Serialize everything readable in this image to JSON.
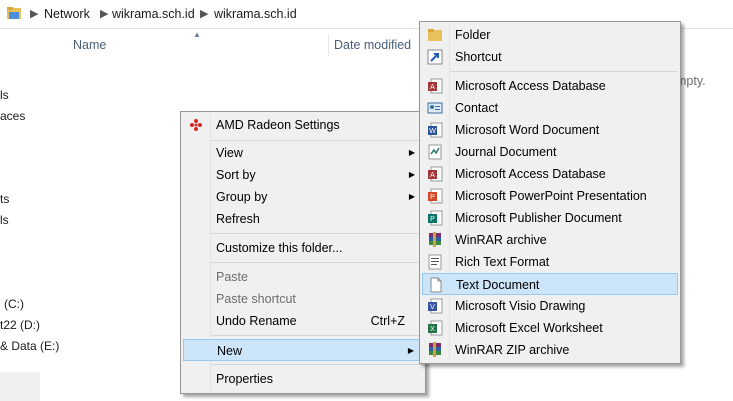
{
  "breadcrumb": [
    "Network",
    "wikrama.sch.id",
    "wikrama.sch.id"
  ],
  "columns": {
    "name": "Name",
    "date_modified": "Date modified"
  },
  "nav": [
    "ls",
    "aces",
    "ts",
    "ls",
    "(C:)",
    "t22 (D:)",
    "& Data (E:)"
  ],
  "empty_message": "mpty.",
  "context_menu": {
    "amd": "AMD Radeon Settings",
    "view": "View",
    "sort_by": "Sort by",
    "group_by": "Group by",
    "refresh": "Refresh",
    "customize": "Customize this folder...",
    "paste": "Paste",
    "paste_shortcut": "Paste shortcut",
    "undo_rename": "Undo Rename",
    "undo_shortcut": "Ctrl+Z",
    "new": "New",
    "properties": "Properties"
  },
  "new_menu": {
    "folder": "Folder",
    "shortcut": "Shortcut",
    "access1": "Microsoft Access Database",
    "contact": "Contact",
    "word": "Microsoft Word Document",
    "journal": "Journal Document",
    "access2": "Microsoft Access Database",
    "powerpoint": "Microsoft PowerPoint Presentation",
    "publisher": "Microsoft Publisher Document",
    "winrar": "WinRAR archive",
    "rtf": "Rich Text Format",
    "text": "Text Document",
    "visio": "Microsoft Visio Drawing",
    "excel": "Microsoft Excel Worksheet",
    "winrar_zip": "WinRAR ZIP archive"
  },
  "colors": {
    "highlight": "#cde5f9",
    "highlight_border": "#99c9ef",
    "menu_bg": "#f0f0f0"
  }
}
